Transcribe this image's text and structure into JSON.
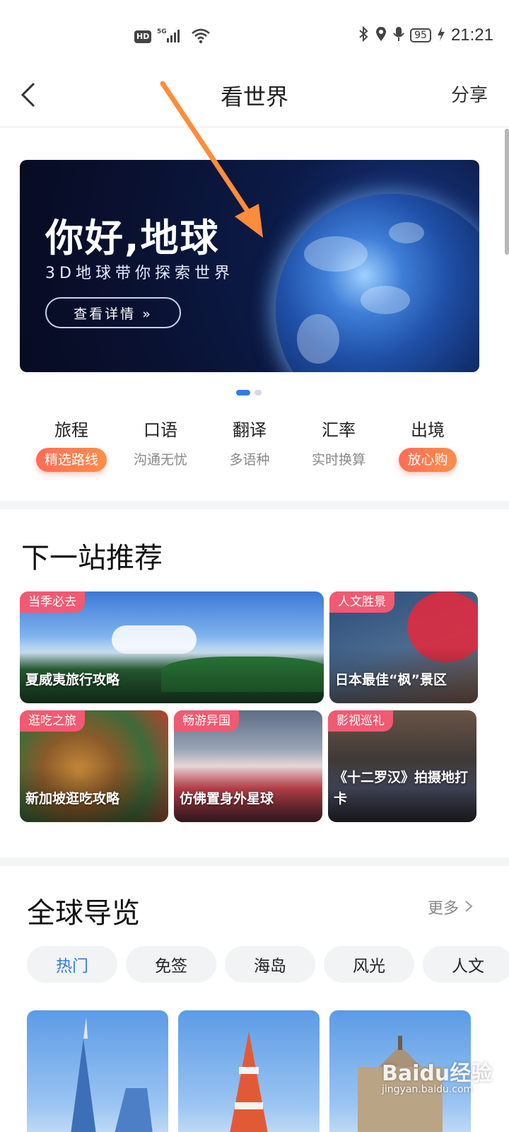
{
  "status_bar": {
    "hd": "HD",
    "network": "5G",
    "battery": "95",
    "time": "21:21"
  },
  "nav": {
    "title": "看世界",
    "share_label": "分享"
  },
  "banner": {
    "title": "你好,地球",
    "subtitle": "3D地球带你探索世界",
    "button_label": "查看详情 »"
  },
  "quick_menu": [
    {
      "title": "旅程",
      "sub": "精选路线",
      "highlight": true
    },
    {
      "title": "口语",
      "sub": "沟通无忧",
      "highlight": false
    },
    {
      "title": "翻译",
      "sub": "多语种",
      "highlight": false
    },
    {
      "title": "汇率",
      "sub": "实时换算",
      "highlight": false
    },
    {
      "title": "出境",
      "sub": "放心购",
      "highlight": true
    }
  ],
  "recommend": {
    "title": "下一站推荐",
    "cards": [
      {
        "tag": "当季必去",
        "caption": "夏威夷旅行攻略"
      },
      {
        "tag": "人文胜景",
        "caption": "日本最佳“枫”景区"
      },
      {
        "tag": "逛吃之旅",
        "caption": "新加坡逛吃攻略"
      },
      {
        "tag": "畅游异国",
        "caption": "仿佛置身外星球"
      },
      {
        "tag": "影视巡礼",
        "caption": "《十二罗汉》拍摄地打卡"
      }
    ]
  },
  "guide": {
    "title": "全球导览",
    "more_label": "更多",
    "tabs": [
      "热门",
      "免签",
      "海岛",
      "风光",
      "人文"
    ],
    "active_tab": "热门"
  },
  "watermark": {
    "brand": "Baidu经验",
    "url": "jingyan.baidu.com"
  },
  "colors": {
    "accent_blue": "#2e7de8",
    "tag_pink": "#f05a72",
    "highlight_orange": "#ff7a4f",
    "annotation_arrow": "#ff8c3a"
  }
}
